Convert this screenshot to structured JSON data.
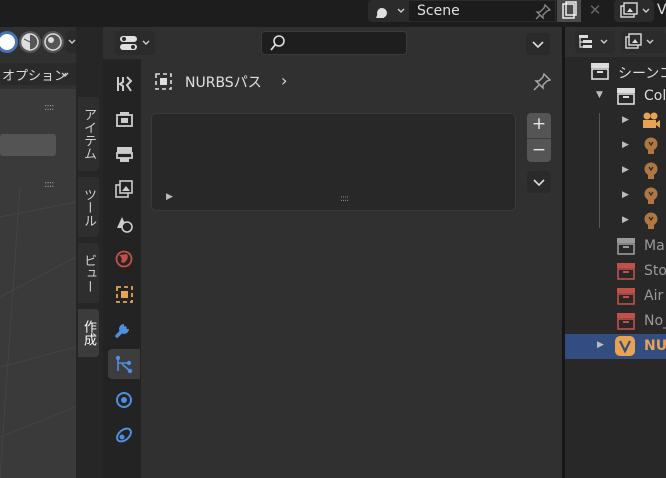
{
  "topbar": {
    "scene_name": "Scene",
    "view_layer_label_partial": "V",
    "icons": [
      "scene-data-icon",
      "pin-icon",
      "new-scene-icon",
      "close-icon",
      "view-layer-icon"
    ]
  },
  "viewport": {
    "options_label": "オプション",
    "grip_glyph": "::::",
    "shading_icons": [
      "solid-shading-icon",
      "material-shading-icon",
      "rendered-shading-icon"
    ]
  },
  "n_panel": {
    "tabs": [
      {
        "label": "アイテム",
        "active": false
      },
      {
        "label": "ツール",
        "active": false
      },
      {
        "label": "ビュー",
        "active": false
      },
      {
        "label": "作成",
        "active": true
      }
    ]
  },
  "properties": {
    "search_placeholder": "",
    "breadcrumb": {
      "label": "NURBSパス",
      "chevron": "›"
    },
    "tabs": [
      {
        "name": "tool-icon",
        "active": false
      },
      {
        "name": "render-icon",
        "active": false
      },
      {
        "name": "output-icon",
        "active": false
      },
      {
        "name": "view-layer-icon",
        "active": false
      },
      {
        "name": "scene-icon",
        "active": false
      },
      {
        "name": "world-icon",
        "active": false
      },
      {
        "name": "object-icon",
        "active": false
      },
      {
        "name": "modifier-icon",
        "active": false
      },
      {
        "name": "curve-data-icon",
        "active": true
      },
      {
        "name": "physics-icon",
        "active": false
      },
      {
        "name": "constraint-icon",
        "active": false
      }
    ],
    "list_controls": {
      "add": "+",
      "remove": "−"
    },
    "panel_grip": "::::"
  },
  "outliner": {
    "rows": [
      {
        "label": "シーンコ",
        "style": "normal",
        "icon": "scene-collection-icon",
        "expanded": false,
        "level": 0,
        "selected": false
      },
      {
        "label": "Col",
        "style": "normal",
        "icon": "collection-icon",
        "expanded": true,
        "level": 1,
        "selected": false
      },
      {
        "label": "",
        "style": "normal",
        "icon": "camera-object-icon",
        "expanded": false,
        "level": 2,
        "selected": false
      },
      {
        "label": "",
        "style": "normal",
        "icon": "light-object-icon",
        "expanded": false,
        "level": 2,
        "selected": false
      },
      {
        "label": "",
        "style": "normal",
        "icon": "light-object-icon",
        "expanded": false,
        "level": 2,
        "selected": false
      },
      {
        "label": "",
        "style": "normal",
        "icon": "light-object-icon",
        "expanded": false,
        "level": 2,
        "selected": false
      },
      {
        "label": "",
        "style": "normal",
        "icon": "light-object-icon",
        "expanded": false,
        "level": 2,
        "selected": false
      },
      {
        "label": "Ma",
        "style": "dim",
        "icon": "collection-icon",
        "expanded": false,
        "level": 1,
        "selected": false
      },
      {
        "label": "Sto",
        "style": "dim",
        "icon": "collection-red-icon",
        "expanded": false,
        "level": 1,
        "selected": false
      },
      {
        "label": "Air",
        "style": "dim",
        "icon": "collection-red-icon",
        "expanded": false,
        "level": 1,
        "selected": false
      },
      {
        "label": "No_",
        "style": "dim",
        "icon": "collection-red-icon",
        "expanded": false,
        "level": 1,
        "selected": false
      },
      {
        "label": "NU",
        "style": "orange",
        "icon": "curve-object-icon",
        "expanded": false,
        "level": 1,
        "selected": true
      }
    ]
  },
  "colors": {
    "accent_blue": "#4772b3",
    "selection_bg": "#334d80",
    "orange": "#e8a352",
    "collection_red": "#c0504a"
  }
}
